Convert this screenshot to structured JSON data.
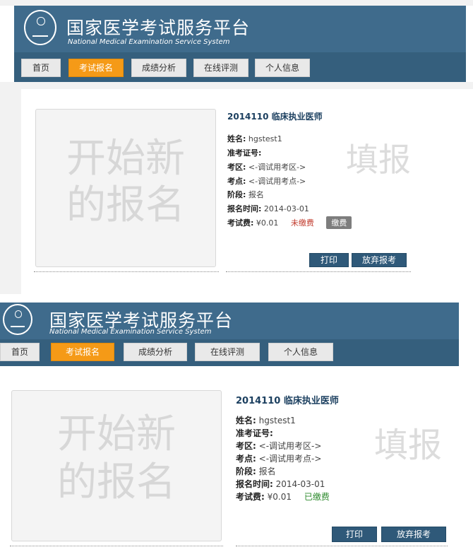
{
  "header": {
    "title_cn": "国家医学考试服务平台",
    "title_en": "National Medical Examination Service System"
  },
  "nav": {
    "items": [
      {
        "label": "首页"
      },
      {
        "label": "考试报名"
      },
      {
        "label": "成绩分析"
      },
      {
        "label": "在线评测"
      },
      {
        "label": "个人信息"
      }
    ]
  },
  "card": {
    "new_line1": "开始新",
    "new_line2": "的报名"
  },
  "watermark": "填报",
  "registration": {
    "exam_title": "2014110 临床执业医师",
    "name_label": "姓名:",
    "name_value": "hgstest1",
    "ticket_label": "准考证号:",
    "ticket_value": "",
    "area_label": "考区:",
    "area_value": "<-调试用考区->",
    "site_label": "考点:",
    "site_value": "<-调试用考点->",
    "stage_label": "阶段:",
    "stage_value": "报名",
    "time_label": "报名时间:",
    "time_value": "2014-03-01",
    "fee_label": "考试费:",
    "fee_value": "¥0.01"
  },
  "panel1": {
    "status": "未缴费",
    "pay_button": "缴费"
  },
  "panel2": {
    "status": "已缴费"
  },
  "actions": {
    "print": "打印",
    "abandon": "放弃报考"
  },
  "colors": {
    "header": "#3f6b8c",
    "nav_bar": "#355f7d",
    "active_tab": "#f59a17",
    "button": "#2f5979",
    "unpaid": "#c0392b",
    "paid": "#2e8b2e"
  }
}
